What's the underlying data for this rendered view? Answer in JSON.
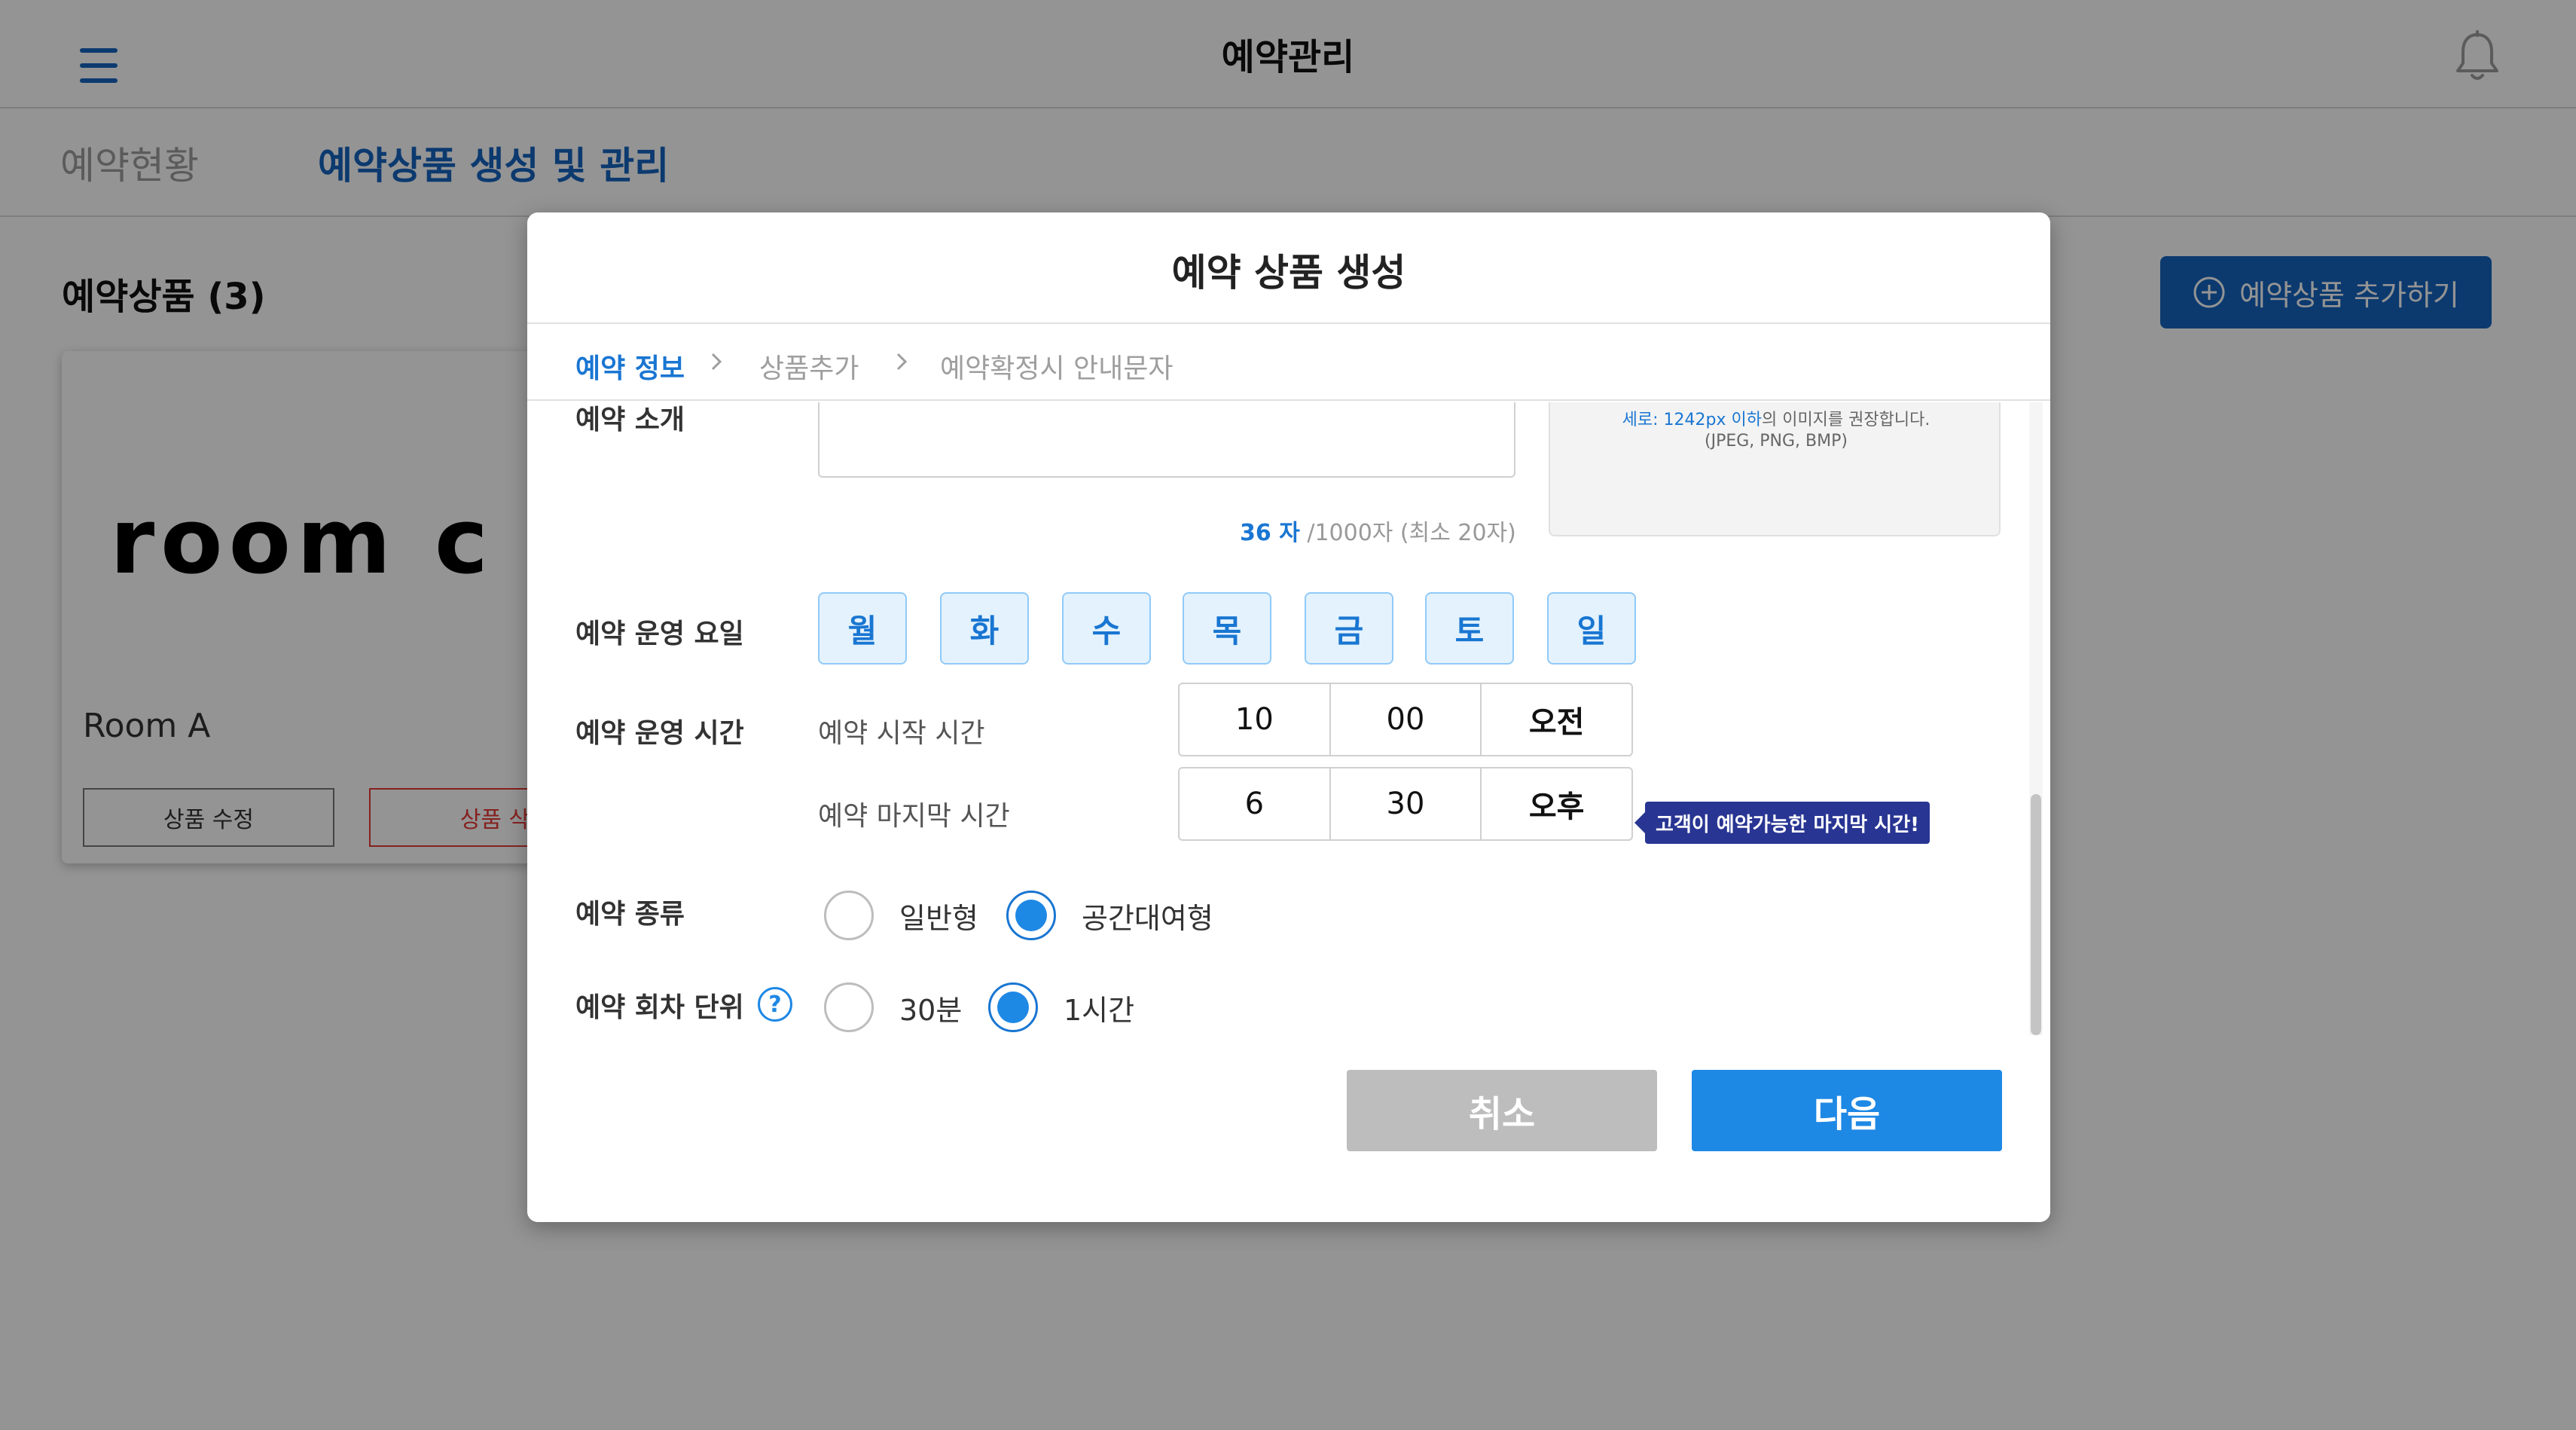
{
  "app": {
    "title": "예약관리",
    "tabs": [
      {
        "label": "예약현황",
        "active": false
      },
      {
        "label": "예약상품 생성 및 관리",
        "active": true
      }
    ]
  },
  "product_list": {
    "title": "예약상품 (3)",
    "add_button_label": "예약상품 추가하기",
    "card": {
      "logo_text": "room c",
      "name": "Room A",
      "edit_label": "상품 수정",
      "delete_label": "상품 삭"
    }
  },
  "modal": {
    "title": "예약 상품 생성",
    "steps": [
      {
        "label": "예약 정보",
        "active": true
      },
      {
        "label": "상품추가",
        "active": false
      },
      {
        "label": "예약확정시 안내문자",
        "active": false
      }
    ],
    "intro": {
      "label": "예약 소개",
      "char_count": "36 자",
      "char_limit": "/1000자 (최소 20자)"
    },
    "image_hint": {
      "highlight": "세로: 1242px 이하",
      "text": "의 이미지를 권장합니다.",
      "formats": "(JPEG, PNG, BMP)"
    },
    "days": {
      "label": "예약 운영 요일",
      "items": [
        "월",
        "화",
        "수",
        "목",
        "금",
        "토",
        "일"
      ]
    },
    "hours": {
      "label": "예약 운영 시간",
      "start": {
        "label": "예약 시작 시간",
        "hour": "10",
        "minute": "00",
        "ampm": "오전"
      },
      "end": {
        "label": "예약 마지막 시간",
        "hour": "6",
        "minute": "30",
        "ampm": "오후"
      },
      "tooltip": "고객이 예약가능한 마지막 시간!"
    },
    "type": {
      "label": "예약 종류",
      "options": [
        {
          "label": "일반형",
          "selected": false
        },
        {
          "label": "공간대여형",
          "selected": true
        }
      ]
    },
    "unit": {
      "label": "예약 회차 단위",
      "help": "?",
      "options": [
        {
          "label": "30분",
          "selected": false
        },
        {
          "label": "1시간",
          "selected": true
        }
      ]
    },
    "buttons": {
      "cancel": "취소",
      "next": "다음"
    }
  },
  "colors": {
    "primary": "#1e88e5",
    "brand_dark": "#1565c0",
    "tooltip_bg": "#283593",
    "day_bg": "#e3f2fd",
    "cancel_bg": "#bdbdbd"
  }
}
